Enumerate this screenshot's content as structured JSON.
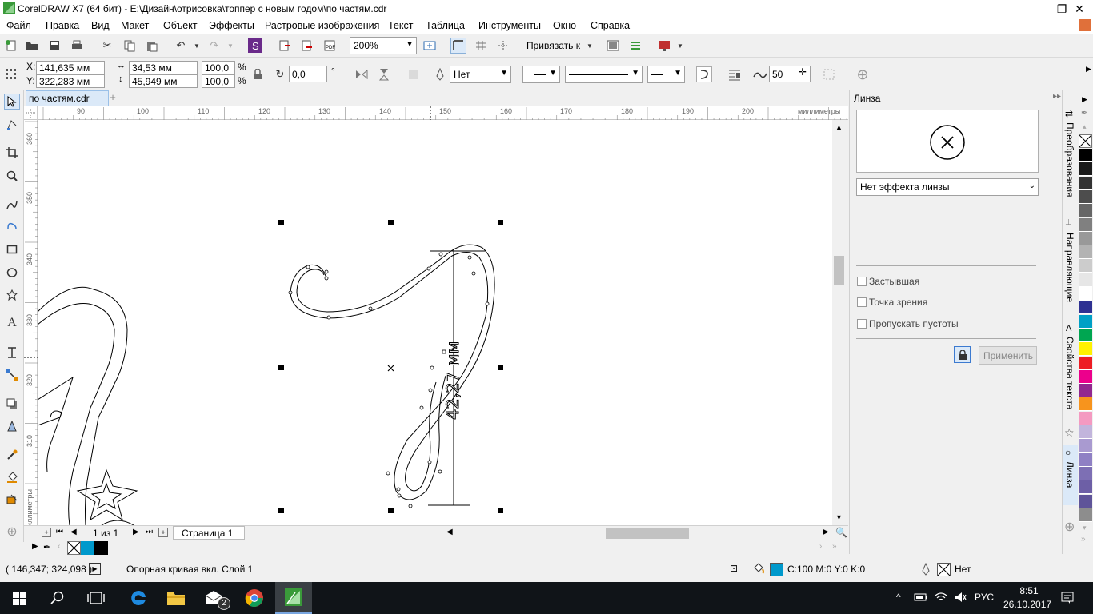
{
  "window": {
    "title": "CorelDRAW X7 (64 бит) - E:\\Дизайн\\отрисовка\\топпер с новым годом\\по частям.cdr",
    "minimize": "—",
    "restore": "❐",
    "close": "✕"
  },
  "menu": [
    "Файл",
    "Правка",
    "Вид",
    "Макет",
    "Объект",
    "Эффекты",
    "Растровые изображения",
    "Текст",
    "Таблица",
    "Инструменты",
    "Окно",
    "Справка"
  ],
  "toolbar": {
    "zoom": "200%",
    "snap_label": "Привязать к"
  },
  "property_bar": {
    "x_label": "X:",
    "x_value": "141,635 мм",
    "y_label": "Y:",
    "y_value": "322,283 мм",
    "width_value": "34,53 мм",
    "height_value": "45,949 мм",
    "scale_w": "100,0",
    "scale_h": "100,0",
    "percent": "%",
    "rotation": "0,0",
    "degree": "°",
    "outline_width": "Нет",
    "smoothing": "50"
  },
  "document": {
    "tab_name": "по частям.cdr",
    "page_counter": "1 из 1",
    "page_tab": "Страница 1",
    "ruler_unit": "миллиметры",
    "h_ruler_ticks": [
      "90",
      "100",
      "110",
      "120",
      "130",
      "140",
      "150",
      "160",
      "170",
      "180",
      "190",
      "200"
    ],
    "v_ruler_ticks": [
      "360",
      "350",
      "340",
      "330",
      "320",
      "310"
    ],
    "dimension_text": "42,27 мм"
  },
  "docker": {
    "title": "Линза",
    "effect_select": "Нет эффекта линзы",
    "options": [
      "Застывшая",
      "Точка зрения",
      "Пропускать пустоты"
    ],
    "apply_button": "Применить",
    "tabs": [
      "Преобразования",
      "Направляющие",
      "Свойства текста",
      "Линза"
    ]
  },
  "palette_colors": [
    "#000000",
    "#1a1a1a",
    "#333333",
    "#4d4d4d",
    "#666666",
    "#808080",
    "#999999",
    "#b3b3b3",
    "#cccccc",
    "#e6e6e6",
    "#ffffff",
    "#2e3192",
    "#00a0c6",
    "#00a651",
    "#fff200",
    "#ed1c24",
    "#ec008c",
    "#92278f",
    "#f7941d",
    "#f49ac1",
    "#c2b5dc",
    "#a99ad0",
    "#8f80c4",
    "#7d6fb4",
    "#6d5fa6",
    "#5f5499",
    "#8d8d8d"
  ],
  "statusbar": {
    "coords": "( 146,347; 324,098 )",
    "info": "Опорная кривая вкл. Слой 1",
    "fill_info": "C:100 M:0 Y:0 K:0",
    "outline_info": "Нет",
    "fill_color": "#0099cc"
  },
  "taskbar": {
    "lang": "РУС",
    "time": "8:51",
    "date": "26.10.2017",
    "mail_badge": "2"
  }
}
